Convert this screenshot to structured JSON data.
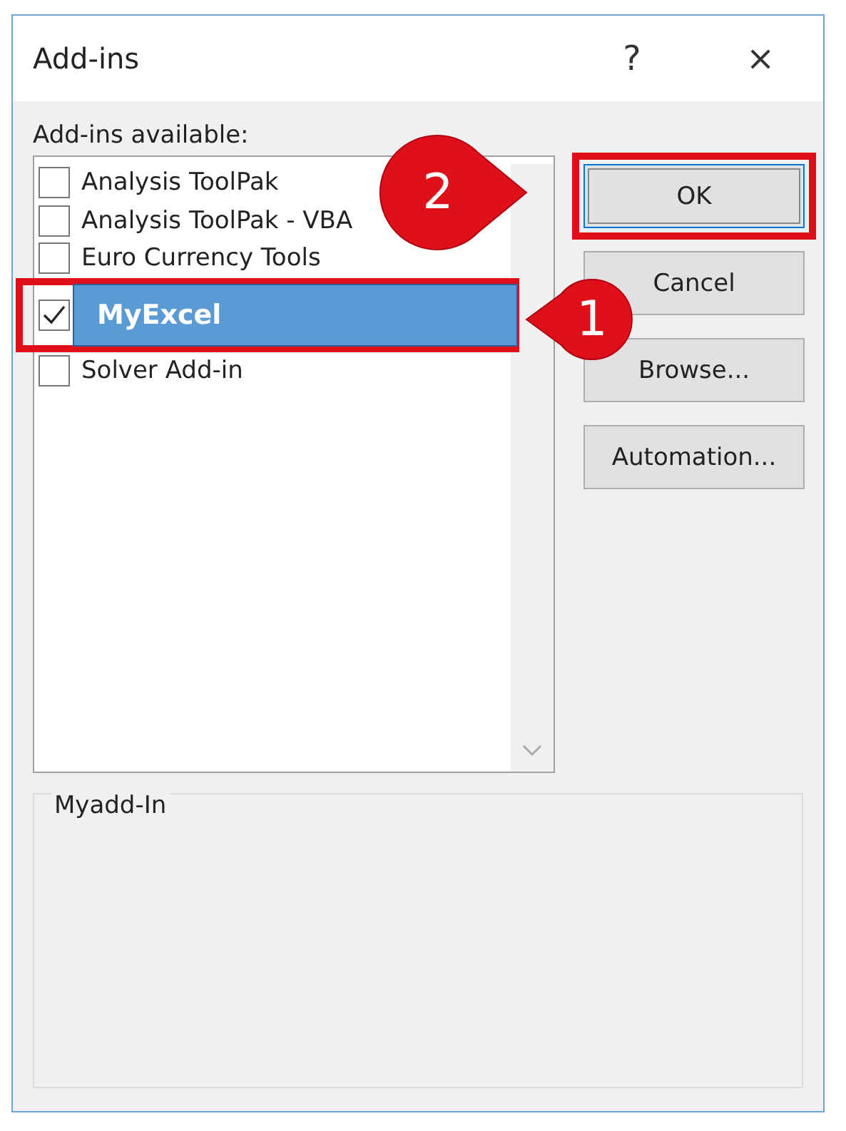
{
  "window": {
    "title": "Add-ins",
    "help": "?",
    "close": "×"
  },
  "list": {
    "label": "Add-ins available:",
    "items": [
      {
        "label": "Analysis ToolPak",
        "checked": false,
        "selected": false
      },
      {
        "label": "Analysis ToolPak - VBA",
        "checked": false,
        "selected": false
      },
      {
        "label": "Euro Currency Tools",
        "checked": false,
        "selected": false
      },
      {
        "label": "MyExcel",
        "checked": true,
        "selected": true
      },
      {
        "label": "Solver Add-in",
        "checked": false,
        "selected": false
      }
    ]
  },
  "buttons": [
    {
      "label": "OK",
      "default": true,
      "highlighted": true
    },
    {
      "label": "Cancel",
      "default": false,
      "highlighted": false
    },
    {
      "label": "Browse...",
      "default": false,
      "highlighted": false
    },
    {
      "label": "Automation...",
      "default": false,
      "highlighted": false
    }
  ],
  "description": {
    "title": "Myadd-In"
  },
  "callouts": [
    {
      "number": "1",
      "kind": "left"
    },
    {
      "number": "2",
      "kind": "right"
    }
  ]
}
